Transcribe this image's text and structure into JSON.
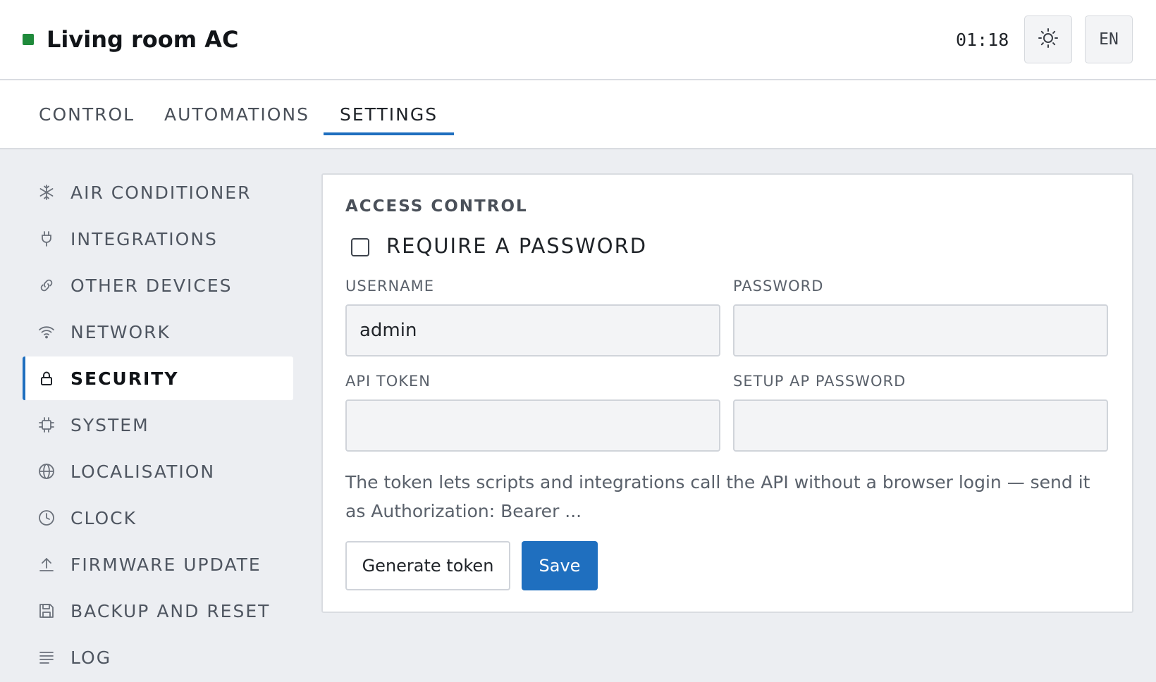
{
  "header": {
    "title": "Living room AC",
    "status_color": "#1f8a3b",
    "time": "01:18",
    "theme_icon": "sun-icon",
    "language": "EN"
  },
  "tabs": [
    {
      "label": "CONTROL",
      "active": false
    },
    {
      "label": "AUTOMATIONS",
      "active": false
    },
    {
      "label": "SETTINGS",
      "active": true
    }
  ],
  "sidebar": {
    "items": [
      {
        "label": "AIR CONDITIONER",
        "icon": "snowflake-icon"
      },
      {
        "label": "INTEGRATIONS",
        "icon": "plug-icon"
      },
      {
        "label": "OTHER DEVICES",
        "icon": "link-icon"
      },
      {
        "label": "NETWORK",
        "icon": "wifi-icon"
      },
      {
        "label": "SECURITY",
        "icon": "lock-icon",
        "active": true
      },
      {
        "label": "SYSTEM",
        "icon": "chip-icon"
      },
      {
        "label": "LOCALISATION",
        "icon": "globe-icon"
      },
      {
        "label": "CLOCK",
        "icon": "clock-icon"
      },
      {
        "label": "FIRMWARE UPDATE",
        "icon": "upload-icon"
      },
      {
        "label": "BACKUP AND RESET",
        "icon": "save-icon"
      },
      {
        "label": "LOG",
        "icon": "lines-icon"
      }
    ]
  },
  "access_control": {
    "title": "ACCESS CONTROL",
    "require_password_label": "REQUIRE A PASSWORD",
    "require_password_checked": false,
    "username_label": "USERNAME",
    "username_value": "admin",
    "password_label": "PASSWORD",
    "password_value": "",
    "api_token_label": "API TOKEN",
    "api_token_value": "",
    "setup_ap_password_label": "SETUP AP PASSWORD",
    "setup_ap_password_value": "",
    "help_text": "The token lets scripts and integrations call the API without a browser login — send it as Authorization: Bearer ...",
    "generate_token_label": "Generate token",
    "save_label": "Save"
  },
  "colors": {
    "accent": "#1f6fbf",
    "status_green": "#1f8a3b"
  }
}
